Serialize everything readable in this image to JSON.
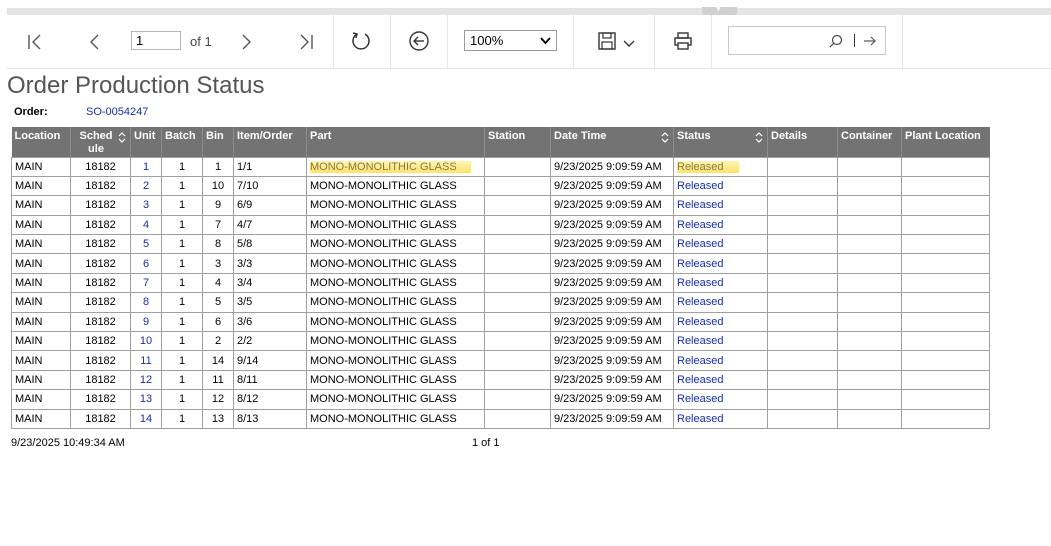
{
  "toolbar": {
    "page_value": "1",
    "page_of": "of 1",
    "zoom": "100%",
    "search_placeholder": ""
  },
  "report": {
    "title": "Order Production Status",
    "order_label": "Order:",
    "order_value": "SO-0054247",
    "columns": [
      "Location",
      "Sched ule",
      "Unit",
      "Batch",
      "Bin",
      "Item/Order",
      "Part",
      "Station",
      "Date Time",
      "Status",
      "Details",
      "Container",
      "Plant Location"
    ],
    "rows": [
      {
        "location": "MAIN",
        "schedule": "18182",
        "unit": "1",
        "batch": "1",
        "bin": "1",
        "item_order": "1/1",
        "part": "MONO-MONOLITHIC GLASS",
        "station": "",
        "date_time": "9/23/2025 9:09:59 AM",
        "status": "Released",
        "details": "",
        "container": "",
        "plant_location": ""
      },
      {
        "location": "MAIN",
        "schedule": "18182",
        "unit": "2",
        "batch": "1",
        "bin": "10",
        "item_order": "7/10",
        "part": "MONO-MONOLITHIC GLASS",
        "station": "",
        "date_time": "9/23/2025 9:09:59 AM",
        "status": "Released",
        "details": "",
        "container": "",
        "plant_location": ""
      },
      {
        "location": "MAIN",
        "schedule": "18182",
        "unit": "3",
        "batch": "1",
        "bin": "9",
        "item_order": "6/9",
        "part": "MONO-MONOLITHIC GLASS",
        "station": "",
        "date_time": "9/23/2025 9:09:59 AM",
        "status": "Released",
        "details": "",
        "container": "",
        "plant_location": ""
      },
      {
        "location": "MAIN",
        "schedule": "18182",
        "unit": "4",
        "batch": "1",
        "bin": "7",
        "item_order": "4/7",
        "part": "MONO-MONOLITHIC GLASS",
        "station": "",
        "date_time": "9/23/2025 9:09:59 AM",
        "status": "Released",
        "details": "",
        "container": "",
        "plant_location": ""
      },
      {
        "location": "MAIN",
        "schedule": "18182",
        "unit": "5",
        "batch": "1",
        "bin": "8",
        "item_order": "5/8",
        "part": "MONO-MONOLITHIC GLASS",
        "station": "",
        "date_time": "9/23/2025 9:09:59 AM",
        "status": "Released",
        "details": "",
        "container": "",
        "plant_location": ""
      },
      {
        "location": "MAIN",
        "schedule": "18182",
        "unit": "6",
        "batch": "1",
        "bin": "3",
        "item_order": "3/3",
        "part": "MONO-MONOLITHIC GLASS",
        "station": "",
        "date_time": "9/23/2025 9:09:59 AM",
        "status": "Released",
        "details": "",
        "container": "",
        "plant_location": ""
      },
      {
        "location": "MAIN",
        "schedule": "18182",
        "unit": "7",
        "batch": "1",
        "bin": "4",
        "item_order": "3/4",
        "part": "MONO-MONOLITHIC GLASS",
        "station": "",
        "date_time": "9/23/2025 9:09:59 AM",
        "status": "Released",
        "details": "",
        "container": "",
        "plant_location": ""
      },
      {
        "location": "MAIN",
        "schedule": "18182",
        "unit": "8",
        "batch": "1",
        "bin": "5",
        "item_order": "3/5",
        "part": "MONO-MONOLITHIC GLASS",
        "station": "",
        "date_time": "9/23/2025 9:09:59 AM",
        "status": "Released",
        "details": "",
        "container": "",
        "plant_location": ""
      },
      {
        "location": "MAIN",
        "schedule": "18182",
        "unit": "9",
        "batch": "1",
        "bin": "6",
        "item_order": "3/6",
        "part": "MONO-MONOLITHIC GLASS",
        "station": "",
        "date_time": "9/23/2025 9:09:59 AM",
        "status": "Released",
        "details": "",
        "container": "",
        "plant_location": ""
      },
      {
        "location": "MAIN",
        "schedule": "18182",
        "unit": "10",
        "batch": "1",
        "bin": "2",
        "item_order": "2/2",
        "part": "MONO-MONOLITHIC GLASS",
        "station": "",
        "date_time": "9/23/2025 9:09:59 AM",
        "status": "Released",
        "details": "",
        "container": "",
        "plant_location": ""
      },
      {
        "location": "MAIN",
        "schedule": "18182",
        "unit": "11",
        "batch": "1",
        "bin": "14",
        "item_order": "9/14",
        "part": "MONO-MONOLITHIC GLASS",
        "station": "",
        "date_time": "9/23/2025 9:09:59 AM",
        "status": "Released",
        "details": "",
        "container": "",
        "plant_location": ""
      },
      {
        "location": "MAIN",
        "schedule": "18182",
        "unit": "12",
        "batch": "1",
        "bin": "11",
        "item_order": "8/11",
        "part": "MONO-MONOLITHIC GLASS",
        "station": "",
        "date_time": "9/23/2025 9:09:59 AM",
        "status": "Released",
        "details": "",
        "container": "",
        "plant_location": ""
      },
      {
        "location": "MAIN",
        "schedule": "18182",
        "unit": "13",
        "batch": "1",
        "bin": "12",
        "item_order": "8/12",
        "part": "MONO-MONOLITHIC GLASS",
        "station": "",
        "date_time": "9/23/2025 9:09:59 AM",
        "status": "Released",
        "details": "",
        "container": "",
        "plant_location": ""
      },
      {
        "location": "MAIN",
        "schedule": "18182",
        "unit": "14",
        "batch": "1",
        "bin": "13",
        "item_order": "8/13",
        "part": "MONO-MONOLITHIC GLASS",
        "station": "",
        "date_time": "9/23/2025 9:09:59 AM",
        "status": "Released",
        "details": "",
        "container": "",
        "plant_location": ""
      }
    ],
    "footer_date": "9/23/2025 10:49:34 AM",
    "footer_page": "1 of 1"
  },
  "colors": {
    "header_bg": "#737373",
    "link": "#1a2fa0",
    "highlight": "#ffd83c"
  },
  "icons": [
    "first-page-icon",
    "previous-page-icon",
    "next-page-icon",
    "last-page-icon",
    "refresh-icon",
    "back-icon",
    "save-icon",
    "chevron-down-icon",
    "print-icon",
    "search-icon",
    "search-next-icon",
    "sort-icon"
  ]
}
